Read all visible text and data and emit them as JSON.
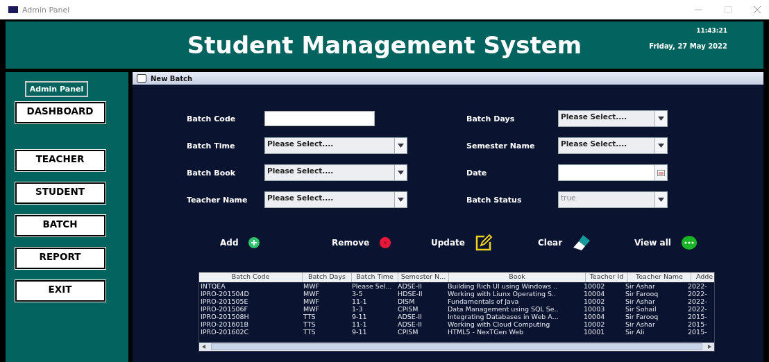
{
  "window": {
    "title": "Admin Panel"
  },
  "header": {
    "title": "Student Management System",
    "time": "11:43:21",
    "date": "Friday, 27 May 2022"
  },
  "sidebar": {
    "heading": "Admin Panel",
    "buttons": [
      "DASHBOARD",
      "TEACHER",
      "STUDENT",
      "BATCH",
      "REPORT",
      "EXIT"
    ]
  },
  "frame": {
    "title": "New Batch",
    "fields": [
      {
        "label": "Batch Code",
        "kind": "text"
      },
      {
        "label": "Batch Days",
        "kind": "combo",
        "value": "Please Select....",
        "disabled": false
      },
      {
        "label": "Batch Time",
        "kind": "combo",
        "value": "Please Select....",
        "disabled": false
      },
      {
        "label": "Semester Name",
        "kind": "combo",
        "value": "Please Select....",
        "disabled": false
      },
      {
        "label": "Batch Book",
        "kind": "combo",
        "value": "Please Select....",
        "disabled": false
      },
      {
        "label": "Date",
        "kind": "date"
      },
      {
        "label": "Teacher Name",
        "kind": "combo",
        "value": "Please Select....",
        "disabled": false
      },
      {
        "label": "Batch Status",
        "kind": "combo",
        "value": "true",
        "disabled": true
      }
    ],
    "actions": [
      {
        "label": "Add",
        "kind": "add"
      },
      {
        "label": "Remove",
        "kind": "remove"
      },
      {
        "label": "Update",
        "kind": "update"
      },
      {
        "label": "Clear",
        "kind": "clear"
      },
      {
        "label": "View all",
        "kind": "view"
      }
    ],
    "table": {
      "columns": [
        "Batch Code",
        "Batch Days",
        "Batch Time",
        "Semester N...",
        "Book",
        "Teacher Id",
        "Teacher Name",
        "Adde"
      ],
      "rows": [
        [
          "INTQEA",
          "MWF",
          "Please Sel...",
          "ADSE-II",
          "Building Rich UI using Windows ..",
          "10002",
          "Sir Ashar",
          "2022-"
        ],
        [
          "IPRO-201504D",
          "MWF",
          "3-5",
          "HDSE-II",
          "Working with Liunx Operating S..",
          "10004",
          "Sir Farooq",
          "2022-"
        ],
        [
          "IPRO-201505E",
          "MWF",
          "11-1",
          "DISM",
          "Fundamentals of Java",
          "10002",
          "Sir Ashar",
          "2022-"
        ],
        [
          "IPRO-201506F",
          "MWF",
          "1-3",
          "CPISM",
          "Data Management using SQL Se..",
          "10003",
          "Sir Sohail",
          "2022-"
        ],
        [
          "IPRO-201508H",
          "TTS",
          "9-11",
          "ADSE-II",
          "Integrating Databases in Web A...",
          "10004",
          "Sir Farooq",
          "2015-"
        ],
        [
          "IPRO-201601B",
          "TTS",
          "11-1",
          "ADSE-II",
          "Working with Cloud Computing",
          "10002",
          "Sir Ashar",
          "2015-"
        ],
        [
          "IPRO-201602C",
          "TTS",
          "9-11",
          "CPISM",
          "HTML5 - NexTGen Web",
          "10001",
          "Sir Ali",
          "2015-"
        ]
      ]
    }
  }
}
